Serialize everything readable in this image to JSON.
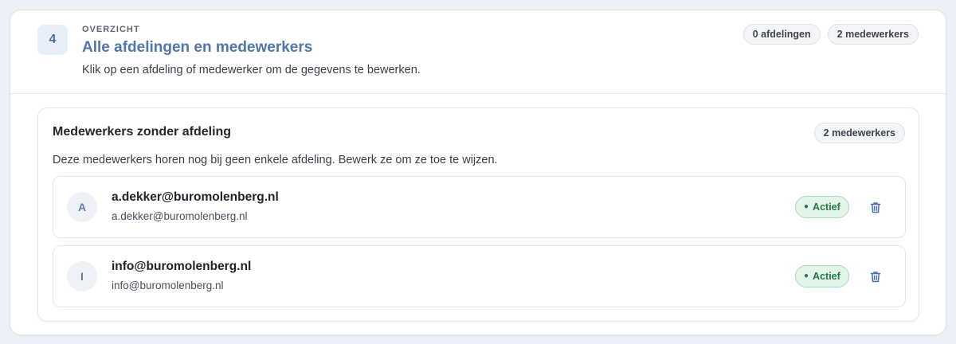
{
  "header": {
    "step_number": "4",
    "eyebrow": "OVERZICHT",
    "title": "Alle afdelingen en medewerkers",
    "subtitle": "Klik op een afdeling of medewerker om de gegevens te bewerken.",
    "counts": {
      "departments": "0 afdelingen",
      "employees": "2 medewerkers"
    }
  },
  "section": {
    "title": "Medewerkers zonder afdeling",
    "count": "2 medewerkers",
    "description": "Deze medewerkers horen nog bij geen enkele afdeling. Bewerk ze om ze toe te wijzen.",
    "employees": [
      {
        "initial": "A",
        "name": "a.dekker@buromolenberg.nl",
        "email": "a.dekker@buromolenberg.nl",
        "status": "Actief",
        "status_dot": "●"
      },
      {
        "initial": "I",
        "name": "info@buromolenberg.nl",
        "email": "info@buromolenberg.nl",
        "status": "Actief",
        "status_dot": "●"
      }
    ]
  },
  "colors": {
    "accent": "#5176a9",
    "status_bg": "#e3f4e9",
    "status_text": "#237a42",
    "trash_icon": "#4a6fa5"
  },
  "icons": {
    "delete": "trash-icon"
  }
}
